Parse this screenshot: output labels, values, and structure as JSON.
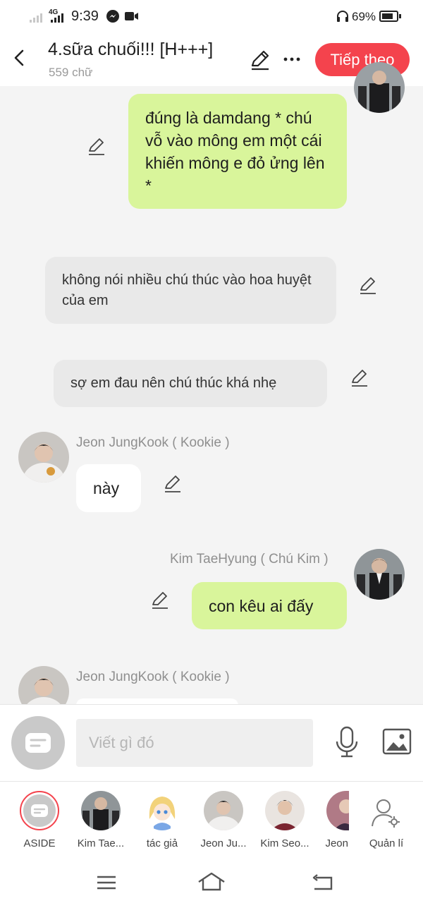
{
  "status": {
    "network": "4G",
    "time": "9:39",
    "battery": "69%"
  },
  "header": {
    "title": "4.sữa chuối!!! [H+++]",
    "word_count": "559 chữ",
    "next_label": "Tiếp theo"
  },
  "messages": [
    {
      "text": "đúng là damdang * chú vỗ vào mông em một cái khiến mông e đỏ ửng lên *"
    },
    {
      "text": "không nói nhiều chú thúc vào hoa huyệt của em"
    },
    {
      "text": "sợ em đau nên chú thúc khá nhẹ"
    },
    {
      "sender": "Jeon JungKook ( Kookie )",
      "text": "này"
    },
    {
      "sender": "Kim TaeHyung ( Chú Kim )",
      "text": "con kêu ai đấy"
    },
    {
      "sender": "Jeon JungKook ( Kookie )"
    }
  ],
  "input": {
    "placeholder": "Viết gì đó"
  },
  "characters": [
    {
      "label": "ASIDE"
    },
    {
      "label": "Kim Tae..."
    },
    {
      "label": "tác giả"
    },
    {
      "label": "Jeon Ju..."
    },
    {
      "label": "Kim Seo..."
    },
    {
      "label": "Jeon"
    },
    {
      "label": "Quản lí"
    }
  ],
  "colors": {
    "accent": "#f4434d",
    "bubble_green": "#d9f59b",
    "bubble_gray": "#e9e9e9"
  }
}
